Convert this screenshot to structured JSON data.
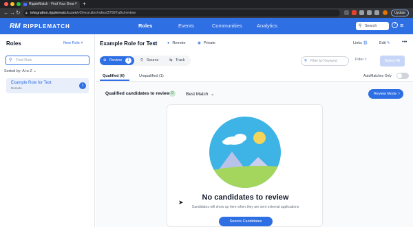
{
  "browser": {
    "tab_title": "RippleMatch - Find Your Drea",
    "tab_close": "×",
    "new_tab": "+",
    "url_host": "integration.ripplematch.com",
    "url_path": "/v2/recruiter/roles/37997a9c/review",
    "update_label": "Update",
    "colors": {
      "close": "#ff5f57",
      "minimize": "#febc2e",
      "maximize": "#28c840"
    }
  },
  "nav": {
    "logo_mark": "RM",
    "logo_text": "RIPPLEMATCH",
    "links": [
      "Roles",
      "Events",
      "Communities",
      "Analytics"
    ],
    "active": "Roles",
    "search_label": "Search",
    "help": "?"
  },
  "sidebar": {
    "title": "Roles",
    "new_role": "New Role",
    "new_role_icon": "+",
    "search_placeholder": "Find Role",
    "sorted_label": "Sorted by: A to Z",
    "roles": [
      {
        "title": "Example Role for Test",
        "location": "Remote",
        "count": "1"
      }
    ]
  },
  "main": {
    "role_title": "Example Role for Test",
    "location": "Remote",
    "visibility": "Private",
    "links_label": "Links",
    "edit_label": "Edit",
    "more": "•••",
    "segments": [
      {
        "label": "Review",
        "count": "1",
        "icon": "review-icon"
      },
      {
        "label": "Source",
        "icon": "search-icon"
      },
      {
        "label": "Track",
        "icon": "track-icon"
      }
    ],
    "keyword_placeholder": "Filter by Keyword",
    "filter_label": "Filter",
    "select_all": "Select All",
    "subtabs": [
      "Qualified (0)",
      "Unqualified (1)"
    ],
    "automatches_label": "AutoMatches Only",
    "automatches_on": false,
    "qualified_label": "Qualified candidates to review",
    "qualified_count": "0",
    "sort_label": "Best Match",
    "review_mode_label": "Review Mode",
    "empty": {
      "title": "No candidates to review",
      "subtitle": "Candidates will show up here when they are sent external applications",
      "button": "Source Candidates"
    }
  },
  "colors": {
    "brand": "#2f6fe4",
    "sky": "#3db3e6",
    "sun": "#f5d45b",
    "grass": "#a4d65e",
    "mountain": "#b9c2e8"
  }
}
